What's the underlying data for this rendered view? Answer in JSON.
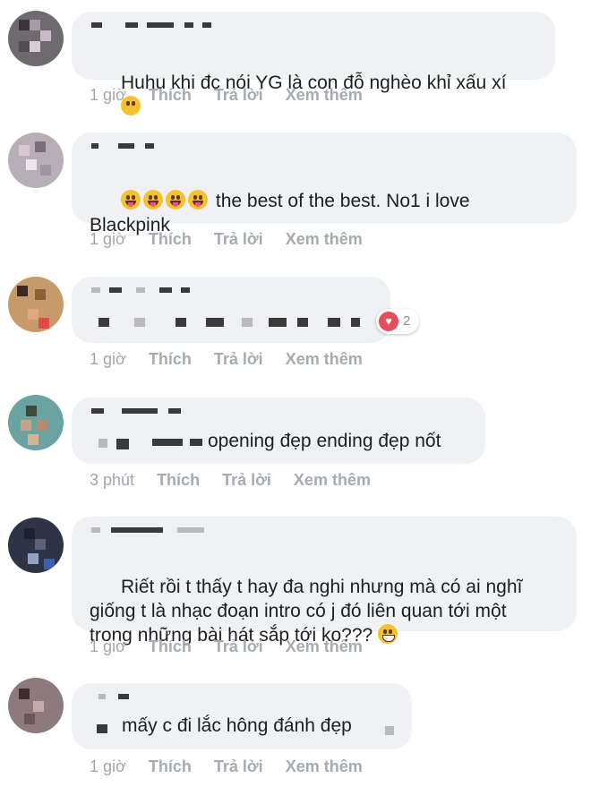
{
  "comments": [
    {
      "text": "Huhu khi đc nói YG là con đỗ nghèo khỉ xấu xí",
      "emoji_end": "crying-face",
      "time": "1 giờ"
    },
    {
      "emoji_start": [
        "tongue-face",
        "tongue-face",
        "tongue-face",
        "tongue-face"
      ],
      "text": "the best of the best. No1 i love\nBlackpink",
      "time": "1 giờ"
    },
    {
      "text": "",
      "reactions": {
        "icon": "heart-icon",
        "count": "2"
      },
      "time": "1 giờ"
    },
    {
      "text": "opening đẹp ending đẹp nốt",
      "time": "3 phút"
    },
    {
      "text": "Riết rồi t thấy t hay đa nghi nhưng mà có ai nghĩ\ngiống t là nhạc đoạn intro có j đó liên quan tới một\ntrong những bài hát sắp tới ko???",
      "emoji_end": "sweat-smile-face",
      "time": "1 giờ"
    },
    {
      "text": "mấy c đi lắc hông đánh đẹp",
      "time": "1 giờ"
    }
  ],
  "actions": {
    "like": "Thích",
    "reply": "Trả lời",
    "more": "Xem thêm"
  },
  "colors": {
    "bubble": "#f0f1f4",
    "text": "#1c1e21",
    "meta": "#a2a7ad"
  }
}
